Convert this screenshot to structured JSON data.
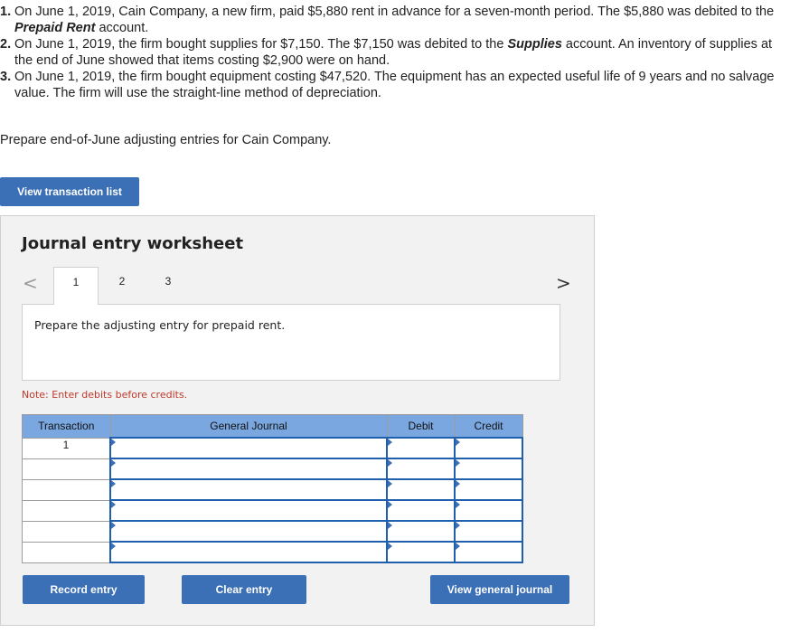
{
  "problem": {
    "items": [
      {
        "num": "1.",
        "line1": "On June 1, 2019, Cain Company, a new firm, paid $5,880 rent in advance for a seven-month period. The $5,880 was debited to the",
        "bold": "Prepaid Rent",
        "line2_rest": " account."
      },
      {
        "num": "2.",
        "line1_pre": "On June 1, 2019, the firm bought supplies for $7,150. The $7,150 was debited to the ",
        "bold": "Supplies",
        "line1_post": " account. An inventory of supplies at",
        "line2": "the end of June showed that items costing $2,900 were on hand."
      },
      {
        "num": "3.",
        "line1": "On June 1, 2019, the firm bought equipment costing $47,520. The equipment has an expected useful life of 9 years and no salvage",
        "line2": "value. The firm will use the straight-line method of depreciation."
      }
    ],
    "instruction": "Prepare end-of-June adjusting entries for Cain Company."
  },
  "buttons": {
    "view_transaction_list": "View transaction list",
    "record_entry": "Record entry",
    "clear_entry": "Clear entry",
    "view_general_journal": "View general journal"
  },
  "worksheet": {
    "title": "Journal entry worksheet",
    "arrow_left": "<",
    "arrow_right": ">",
    "tabs": [
      "1",
      "2",
      "3"
    ],
    "prompt": "Prepare the adjusting entry for prepaid rent.",
    "note": "Note: Enter debits before credits.",
    "columns": [
      "Transaction",
      "General Journal",
      "Debit",
      "Credit"
    ],
    "rows": [
      {
        "transaction": "1"
      },
      {
        "transaction": ""
      },
      {
        "transaction": ""
      },
      {
        "transaction": ""
      },
      {
        "transaction": ""
      },
      {
        "transaction": ""
      }
    ]
  },
  "colors": {
    "accent": "#3b6fb6",
    "table_header": "#7aa7e0",
    "note": "#c0392b"
  }
}
